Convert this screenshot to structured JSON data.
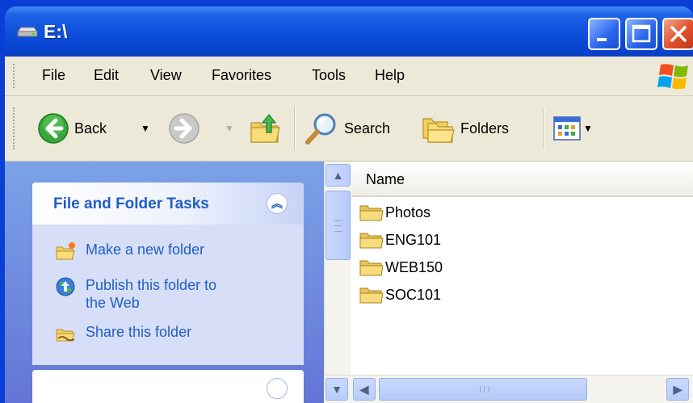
{
  "window": {
    "title": "E:\\"
  },
  "menu": {
    "items": [
      "File",
      "Edit",
      "View",
      "Favorites",
      "Tools",
      "Help"
    ]
  },
  "toolbar": {
    "back_label": "Back",
    "search_label": "Search",
    "folders_label": "Folders"
  },
  "tasks": {
    "title": "File and Folder Tasks",
    "links": [
      "Make a new folder",
      "Publish this folder to the Web",
      "Share this folder"
    ]
  },
  "file_list": {
    "column_header": "Name",
    "items": [
      "Photos",
      "ENG101",
      "WEB150",
      "SOC101"
    ]
  },
  "colors": {
    "title_bar": "#0c4fdb",
    "task_pane": "#6f8ee0",
    "link_text": "#215dc6",
    "folder": "#e8c45a"
  }
}
